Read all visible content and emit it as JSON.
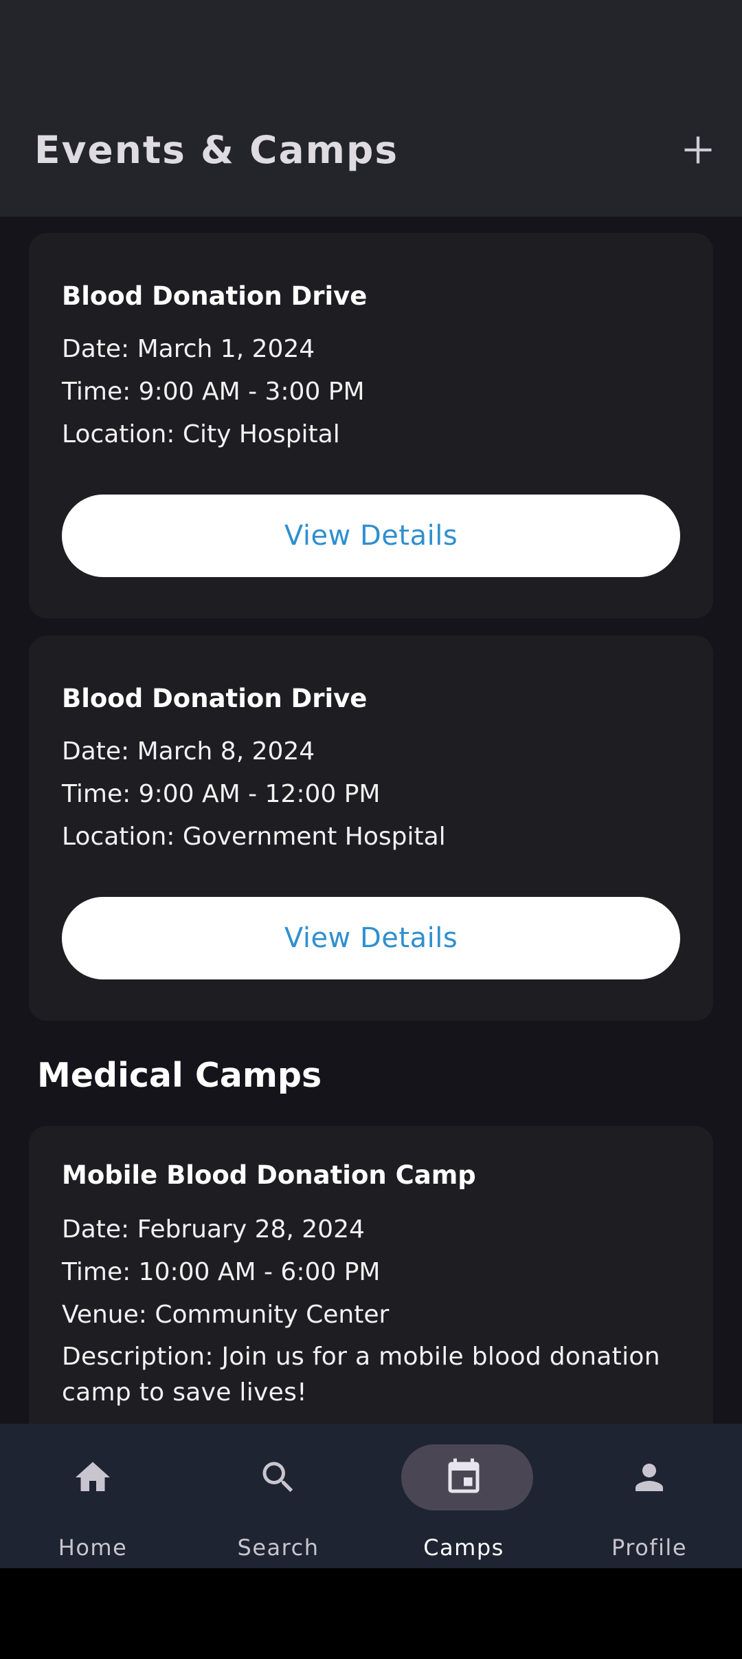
{
  "header": {
    "title": "Events & Camps",
    "add_icon": "plus-icon"
  },
  "events": [
    {
      "title": "Blood Donation Drive",
      "date": "Date: March 1, 2024",
      "time": "Time: 9:00 AM - 3:00 PM",
      "location": "Location: City Hospital",
      "button_label": "View Details"
    },
    {
      "title": "Blood Donation Drive",
      "date": "Date: March 8, 2024",
      "time": "Time: 9:00 AM - 12:00 PM",
      "location": "Location: Government Hospital",
      "button_label": "View Details"
    }
  ],
  "medical_camps": {
    "heading": "Medical Camps",
    "items": [
      {
        "title": "Mobile Blood Donation Camp",
        "date": "Date: February 28, 2024",
        "time": "Time: 10:00 AM - 6:00 PM",
        "venue": "Venue: Community Center",
        "description": "Description: Join us for a mobile blood donation camp to save lives!"
      }
    ]
  },
  "bottom_nav": {
    "active": "Camps",
    "items": [
      {
        "label": "Home",
        "icon": "home-icon"
      },
      {
        "label": "Search",
        "icon": "search-icon"
      },
      {
        "label": "Camps",
        "icon": "calendar-icon"
      },
      {
        "label": "Profile",
        "icon": "person-icon"
      }
    ]
  },
  "colors": {
    "background": "#15141a",
    "header": "#24242b",
    "card": "#1e1e22",
    "button_text": "#2f8fd0",
    "nav_bar": "#1e2431",
    "nav_active_pill": "#4a4654"
  }
}
